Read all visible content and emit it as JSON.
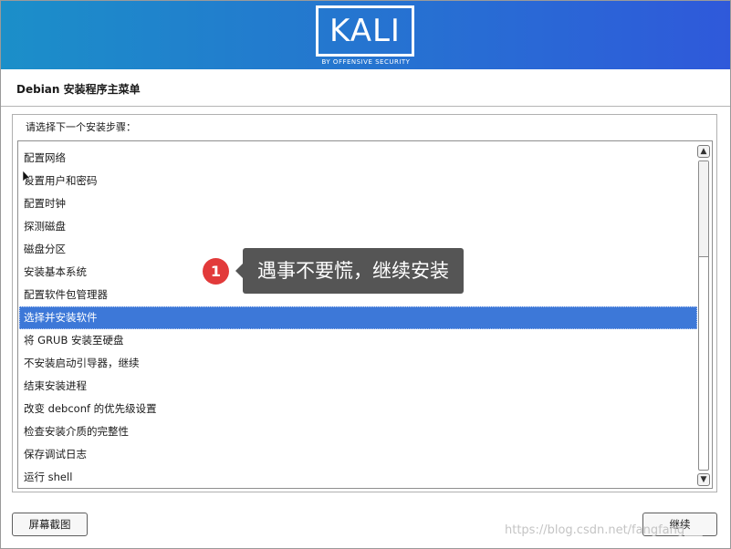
{
  "banner": {
    "logo_text": "KALI",
    "logo_subtitle": "BY OFFENSIVE SECURITY"
  },
  "page": {
    "title": "Debian 安装程序主菜单",
    "prompt": "请选择下一个安装步骤："
  },
  "menu": {
    "items": [
      {
        "label": "配置网络",
        "selected": false
      },
      {
        "label": "设置用户和密码",
        "selected": false
      },
      {
        "label": "配置时钟",
        "selected": false
      },
      {
        "label": "探测磁盘",
        "selected": false
      },
      {
        "label": "磁盘分区",
        "selected": false
      },
      {
        "label": "安装基本系统",
        "selected": false
      },
      {
        "label": "配置软件包管理器",
        "selected": false
      },
      {
        "label": "选择并安装软件",
        "selected": true
      },
      {
        "label": "将 GRUB 安装至硬盘",
        "selected": false
      },
      {
        "label": "不安装启动引导器，继续",
        "selected": false
      },
      {
        "label": "结束安装进程",
        "selected": false
      },
      {
        "label": "改变 debconf 的优先级设置",
        "selected": false
      },
      {
        "label": "检查安装介质的完整性",
        "selected": false
      },
      {
        "label": "保存调试日志",
        "selected": false
      },
      {
        "label": "运行 shell",
        "selected": false
      }
    ],
    "scroll_up_icon": "arrow-up",
    "scroll_down_icon": "arrow-down"
  },
  "annotation": {
    "badge_number": "1",
    "text": "遇事不要慌，继续安装",
    "badge_color": "#e23a3a"
  },
  "buttons": {
    "screenshot_label": "屏幕截图",
    "continue_label": "继续"
  },
  "watermark": "https://blog.csdn.net/fangfang___"
}
